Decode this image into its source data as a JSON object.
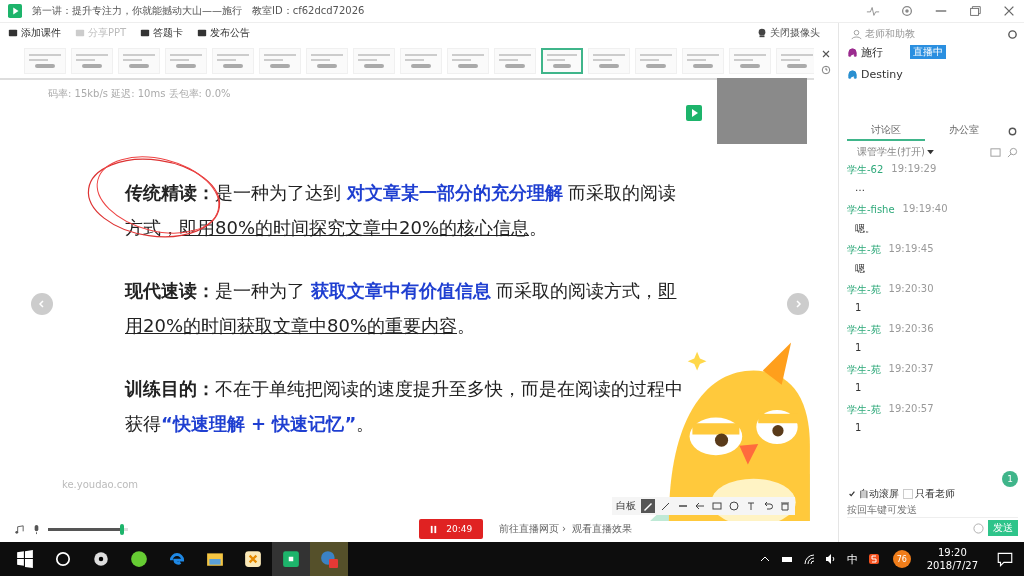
{
  "window": {
    "title": "第一讲：提升专注力，你就能撼动大山——施行",
    "lesson_id": "教室ID：cf62dcd72026"
  },
  "toolbar": {
    "items": [
      {
        "label": "添加课件",
        "disabled": false
      },
      {
        "label": "分享PPT",
        "disabled": true
      },
      {
        "label": "答题卡",
        "disabled": false
      },
      {
        "label": "发布公告",
        "disabled": false
      }
    ],
    "camera": "关闭摄像头"
  },
  "thumbnails": [
    {
      "selected": false
    },
    {
      "selected": false
    },
    {
      "selected": false
    },
    {
      "selected": false
    },
    {
      "selected": false
    },
    {
      "selected": false
    },
    {
      "selected": false
    },
    {
      "selected": false
    },
    {
      "selected": false
    },
    {
      "selected": false
    },
    {
      "selected": false
    },
    {
      "selected": true
    },
    {
      "selected": false
    },
    {
      "selected": false
    },
    {
      "selected": false
    },
    {
      "selected": false
    },
    {
      "selected": false
    }
  ],
  "stats": "码率: 15kb/s   延迟: 10ms   丢包率: 0.0%",
  "slide": {
    "paragraphs": [
      [
        [
          {
            "kind": "label",
            "text": "传统精读："
          },
          {
            "kind": "plain",
            "text": "是一种为了达到 "
          },
          {
            "kind": "highlight",
            "text": "对文章某一部分的充分理解"
          },
          {
            "kind": "plain",
            "text": " 而采取的阅读"
          }
        ],
        [
          {
            "kind": "plain",
            "text": "方式，"
          },
          {
            "kind": "underline",
            "text": "即用80%的时间探究文章中20%的核心信息"
          },
          {
            "kind": "plain",
            "text": "。"
          }
        ]
      ],
      [
        [
          {
            "kind": "label",
            "text": "现代速读："
          },
          {
            "kind": "plain",
            "text": "是一种为了 "
          },
          {
            "kind": "highlight",
            "text": "获取文章中有价值信息"
          },
          {
            "kind": "plain",
            "text": " 而采取的阅读方式，"
          },
          {
            "kind": "underline",
            "text": "即"
          }
        ],
        [
          {
            "kind": "underline",
            "text": "用20%的时间获取文章中80%的重要内容"
          },
          {
            "kind": "plain",
            "text": "。"
          }
        ]
      ],
      [
        [
          {
            "kind": "label",
            "text": "训练目的："
          },
          {
            "kind": "plain",
            "text": "不在于单纯把阅读的速度提升至多快，而是在阅读的过程中"
          }
        ],
        [
          {
            "kind": "plain",
            "text": "获得"
          },
          {
            "kind": "highlight",
            "text": "“快速理解 + 快速记忆”"
          },
          {
            "kind": "plain",
            "text": "。"
          }
        ]
      ]
    ],
    "footer": "ke.youdao.com",
    "whiteboard_label": "白板"
  },
  "controls": {
    "volume": {
      "level": 0.92
    },
    "timer": "20:49",
    "links": [
      "前往直播网页 ›",
      "观看直播效果"
    ]
  },
  "panel": {
    "header": "老师和助教",
    "teachers": [
      {
        "name": "施行",
        "badge": "直播中",
        "color": "#9b2c8f"
      },
      {
        "name": "Destiny",
        "color": "#2a8fd0"
      }
    ],
    "tabs": [
      {
        "label": "讨论区",
        "selected": true
      },
      {
        "label": "办公室",
        "selected": false
      }
    ],
    "filter": "课管学生(打开)",
    "messages": [
      {
        "name": "学生-62",
        "time": "19:19:29",
        "text": "…"
      },
      {
        "name": "学生-fishe",
        "time": "19:19:40",
        "text": "嗯。"
      },
      {
        "name": "学生-苑",
        "time": "19:19:45",
        "text": "嗯"
      },
      {
        "name": "学生-苑",
        "time": "19:20:30",
        "text": "1"
      },
      {
        "name": "学生-苑",
        "time": "19:20:36",
        "text": "1"
      },
      {
        "name": "学生-苑",
        "time": "19:20:37",
        "text": "1"
      },
      {
        "name": "学生-苑",
        "time": "19:20:57",
        "text": "1"
      }
    ],
    "unread": "1",
    "options": [
      {
        "label": "自动滚屏",
        "checked": true
      },
      {
        "label": "只看老师",
        "checked": false
      }
    ],
    "input_placeholder": "按回车键可发送",
    "send": "发送"
  },
  "taskbar": {
    "ime": "中",
    "badge": "76",
    "time": "19:20",
    "date": "2018/7/27"
  }
}
